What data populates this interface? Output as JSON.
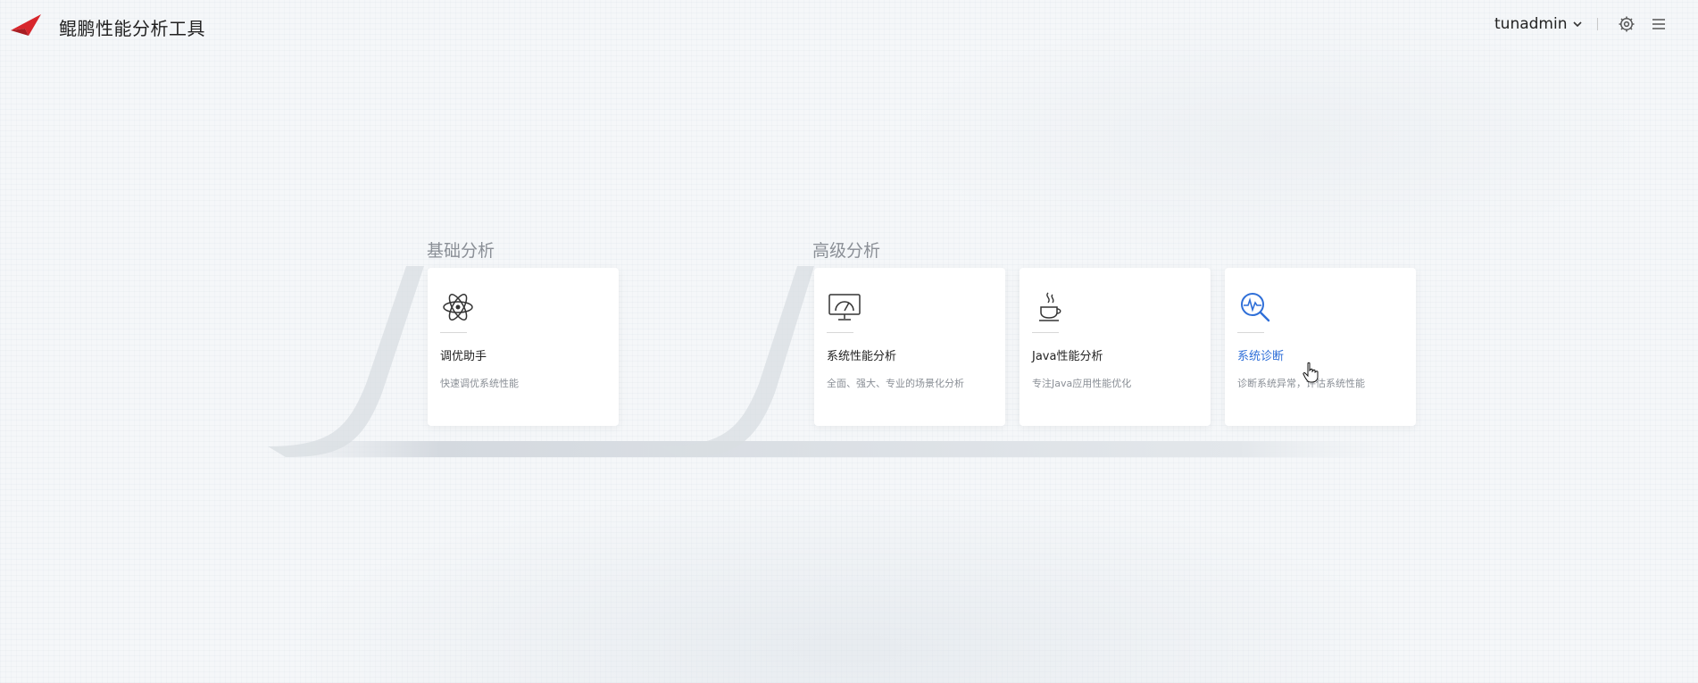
{
  "header": {
    "logo_icon": "kunpeng-logo-icon",
    "title": "鲲鹏性能分析工具",
    "user": "tunadmin",
    "user_menu_icon": "chevron-down-icon",
    "settings_icon": "gear-icon",
    "menu_icon": "hamburger-menu-icon"
  },
  "sections": [
    {
      "title": "基础分析",
      "cards": [
        {
          "name": "调优助手",
          "desc": "快速调优系统性能",
          "icon": "atom-icon"
        }
      ]
    },
    {
      "title": "高级分析",
      "cards": [
        {
          "name": "系统性能分析",
          "desc": "全面、强大、专业的场景化分析",
          "icon": "monitor-gauge-icon"
        },
        {
          "name": "Java性能分析",
          "desc": "专注Java应用性能优化",
          "icon": "java-cup-icon"
        },
        {
          "name": "系统诊断",
          "desc": "诊断系统异常，评估系统性能",
          "icon": "diagnosis-magnifier-icon",
          "state": "hovered"
        }
      ]
    }
  ],
  "colors": {
    "accent": "#2f6fd8",
    "logo_red": "#d7262c",
    "background": "#f5f7f9",
    "muted_text": "#8a8f96"
  }
}
